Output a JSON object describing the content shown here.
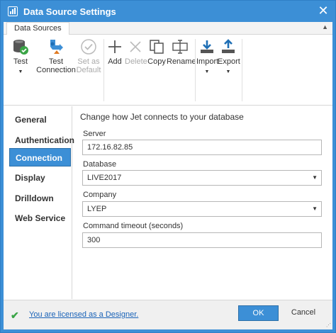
{
  "window": {
    "title": "Data Source Settings",
    "close_glyph": "✕"
  },
  "ribbon": {
    "tab_label": "Data Sources",
    "collapse_glyph": "▲",
    "buttons": [
      {
        "label": "Test",
        "icon": "database-check-icon",
        "has_dropdown": true,
        "enabled": true
      },
      {
        "label": "Test Connection",
        "icon": "test-connection-icon",
        "has_dropdown": false,
        "enabled": true
      },
      {
        "label": "Set as Default",
        "icon": "checkmark-circle-icon",
        "has_dropdown": false,
        "enabled": false
      },
      {
        "label": "Add",
        "icon": "plus-icon",
        "has_dropdown": false,
        "enabled": true
      },
      {
        "label": "Delete",
        "icon": "x-icon",
        "has_dropdown": false,
        "enabled": false
      },
      {
        "label": "Copy",
        "icon": "copy-icon",
        "has_dropdown": false,
        "enabled": true
      },
      {
        "label": "Rename",
        "icon": "rename-icon",
        "has_dropdown": false,
        "enabled": true
      },
      {
        "label": "Import",
        "icon": "import-icon",
        "has_dropdown": true,
        "enabled": true
      },
      {
        "label": "Export",
        "icon": "export-icon",
        "has_dropdown": true,
        "enabled": true
      }
    ],
    "test_label": "Test",
    "test_connection_line1": "Test",
    "test_connection_line2": "Connection",
    "set_default_line1": "Set as",
    "set_default_line2": "Default",
    "add_label": "Add",
    "delete_label": "Delete",
    "copy_label": "Copy",
    "rename_label": "Rename",
    "import_label": "Import",
    "export_label": "Export",
    "dropdown_glyph": "▼"
  },
  "nav": {
    "items": [
      {
        "label": "General",
        "active": false
      },
      {
        "label": "Authentication",
        "active": false
      },
      {
        "label": "Connection",
        "active": true
      },
      {
        "label": "Display",
        "active": false
      },
      {
        "label": "Drilldown",
        "active": false
      },
      {
        "label": "Web Service",
        "active": false
      }
    ]
  },
  "connection": {
    "heading": "Change how Jet connects to your database",
    "server_label": "Server",
    "server_value": "172.16.82.85",
    "database_label": "Database",
    "database_value": "LIVE2017",
    "company_label": "Company",
    "company_value": "LYEP",
    "timeout_label": "Command timeout (seconds)",
    "timeout_value": "300"
  },
  "footer": {
    "check_glyph": "✔",
    "license_text": "You are licensed as a Designer.",
    "ok_label": "OK",
    "cancel_label": "Cancel",
    "grip_glyph": "⋰"
  },
  "colors": {
    "accent": "#3c8fd6",
    "link": "#1a63b8",
    "success": "#3aa546",
    "disabled": "#aaaaaa"
  }
}
